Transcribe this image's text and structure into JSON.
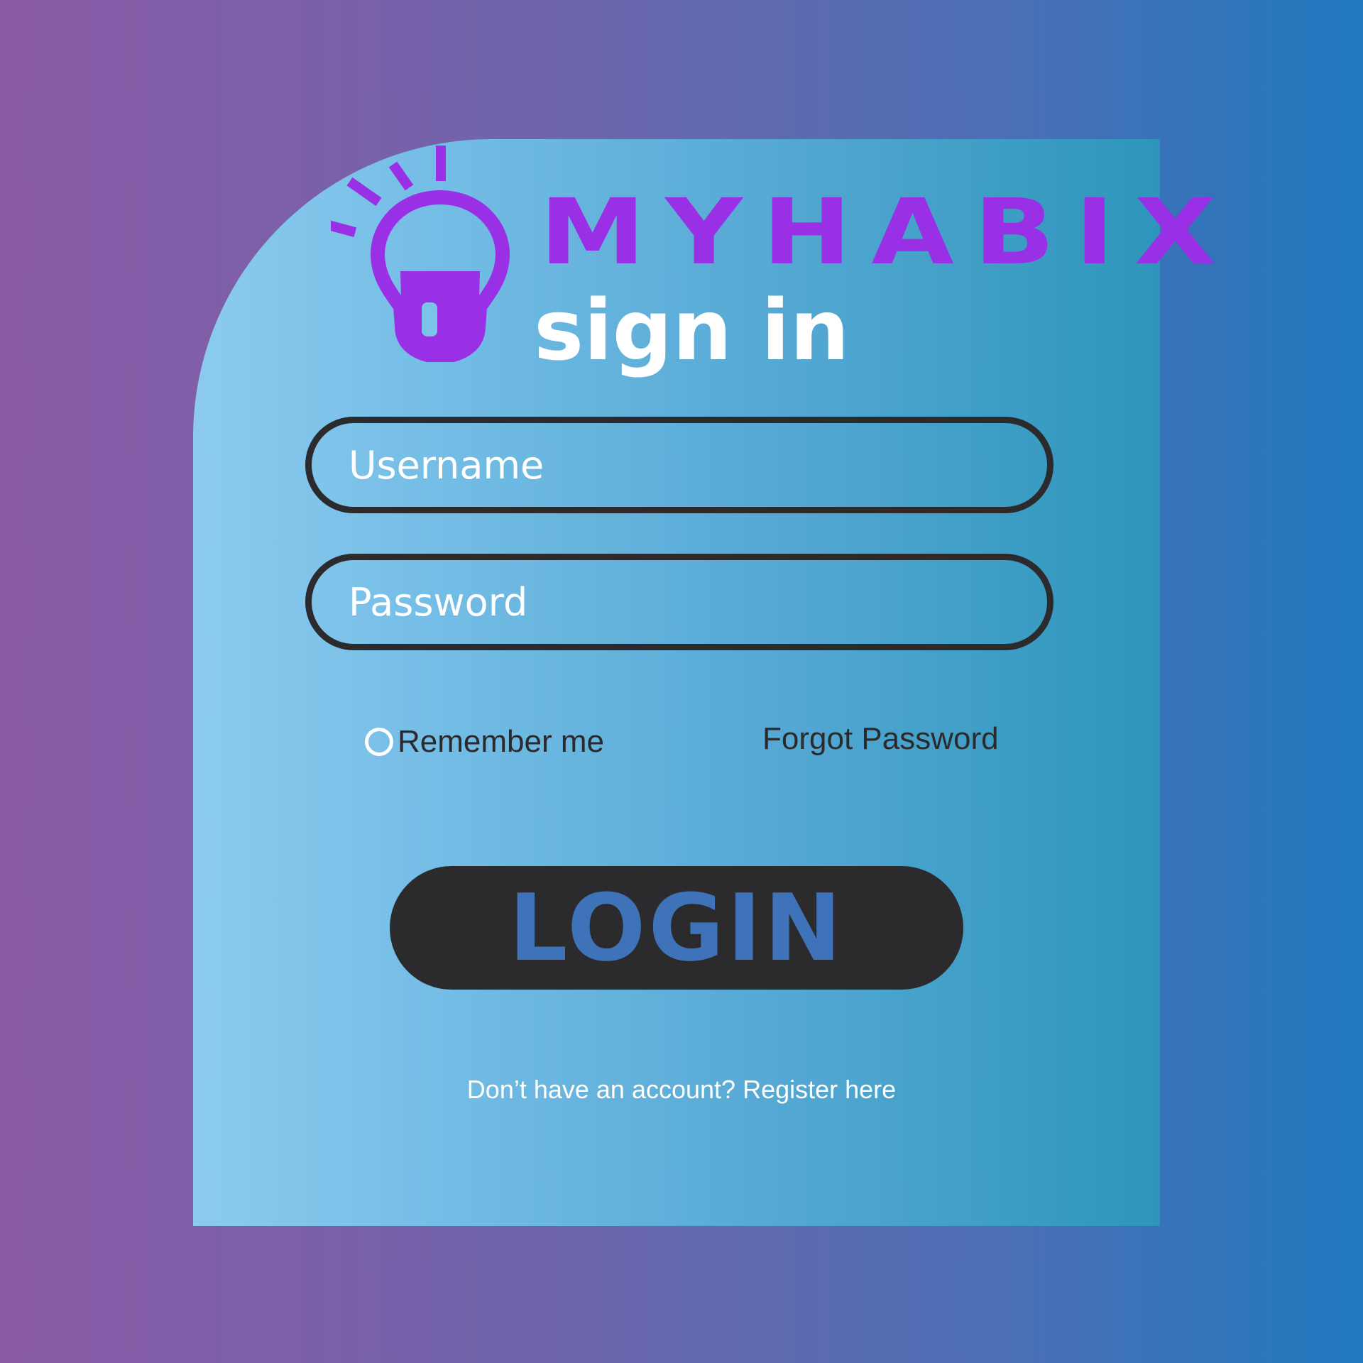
{
  "logo": {
    "brand_name": "MYHABIX",
    "icon": "lightbulb-icon",
    "color": "#9a30e6"
  },
  "page_title": "sign in",
  "form": {
    "username_placeholder": "Username",
    "password_placeholder": "Password",
    "remember_me_label": "Remember me",
    "remember_me_checked": false,
    "forgot_password_label": "Forgot Password",
    "login_label": "LOGIN"
  },
  "footer": {
    "prompt": "Don’t have an account?",
    "register_link": "Register here"
  },
  "colors": {
    "login_text": "#3f73b9",
    "dark": "#2b2a2c"
  }
}
